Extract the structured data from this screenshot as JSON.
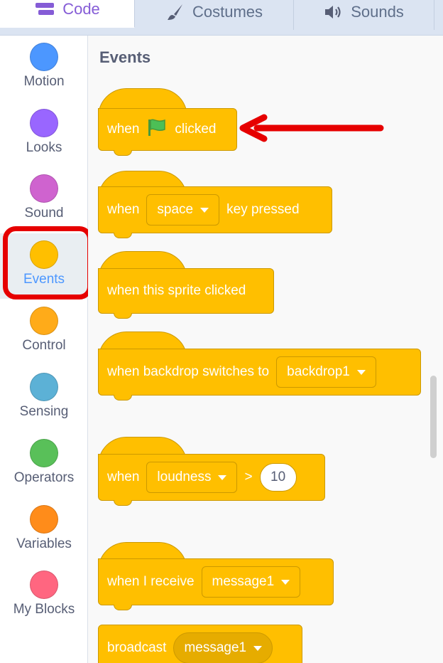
{
  "tabs": [
    {
      "label": "Code",
      "icon": "code-blocks-icon"
    },
    {
      "label": "Costumes",
      "icon": "paintbrush-icon"
    },
    {
      "label": "Sounds",
      "icon": "speaker-icon"
    }
  ],
  "categories": [
    {
      "label": "Motion",
      "color": "#4c97ff"
    },
    {
      "label": "Looks",
      "color": "#9966ff"
    },
    {
      "label": "Sound",
      "color": "#cf63cf"
    },
    {
      "label": "Events",
      "color": "#ffbf00",
      "selected": true
    },
    {
      "label": "Control",
      "color": "#ffab19"
    },
    {
      "label": "Sensing",
      "color": "#5cb1d6"
    },
    {
      "label": "Operators",
      "color": "#59c059"
    },
    {
      "label": "Variables",
      "color": "#ff8c1a"
    },
    {
      "label": "My Blocks",
      "color": "#ff6680"
    }
  ],
  "palette": {
    "heading": "Events",
    "blocks": {
      "flag": {
        "before": "when",
        "after": "clicked"
      },
      "key": {
        "before": "when",
        "dropdown": "space",
        "after": "key pressed"
      },
      "sprite": {
        "text": "when this sprite clicked"
      },
      "backdrop": {
        "before": "when backdrop switches to",
        "dropdown": "backdrop1"
      },
      "loudness": {
        "before": "when",
        "dropdown": "loudness",
        "operator": ">",
        "value": "10"
      },
      "receive": {
        "before": "when I receive",
        "dropdown": "message1"
      },
      "broadcast": {
        "before": "broadcast",
        "dropdown": "message1"
      }
    }
  },
  "colors": {
    "events": "#ffbf00",
    "annotation": "#e60000",
    "selected_text": "#4c97ff"
  }
}
